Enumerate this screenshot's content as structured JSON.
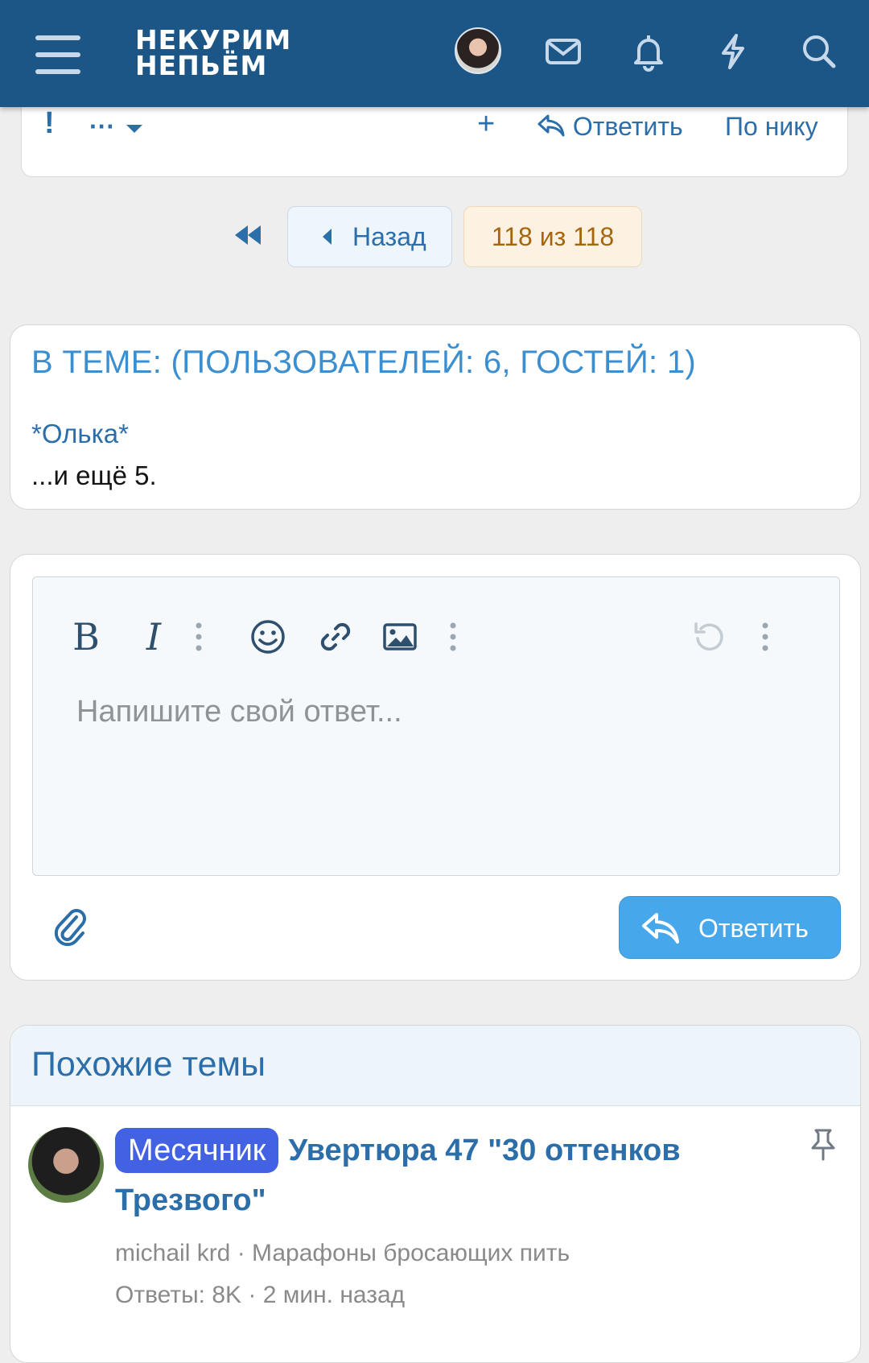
{
  "header": {
    "logo_line1": "НЕКУРИМ",
    "logo_line2": "НЕПЬЁМ",
    "icons": [
      "menu-icon",
      "avatar",
      "mail-icon",
      "bell-icon",
      "lightning-icon",
      "search-icon"
    ]
  },
  "post_actions": {
    "report": "!",
    "more": "···",
    "add": "+",
    "reply": "Ответить",
    "by_nick": "По нику"
  },
  "pagination": {
    "back": "Назад",
    "current": "118 из 118"
  },
  "online": {
    "title": "В ТЕМЕ: (ПОЛЬЗОВАТЕЛЕЙ: 6, ГОСТЕЙ: 1)",
    "user": "*Олька*",
    "more": "...и ещё 5."
  },
  "editor": {
    "bold": "B",
    "italic": "I",
    "placeholder": "Напишите свой ответ...",
    "submit": "Ответить"
  },
  "similar": {
    "heading": "Похожие темы",
    "threads": [
      {
        "prefix": "Месячник",
        "title": "Увертюра 47 \"30 оттенков Трезвого\"",
        "author_forum": "michail krd · Марафоны бросающих пить",
        "stats": "Ответы: 8K · 2 мин. назад"
      }
    ]
  },
  "colors": {
    "header_bg": "#1c5687",
    "link": "#2b6eaa",
    "accent_button": "#47a7eb",
    "prefix_badge": "#4262e3",
    "current_page_bg": "#fdf1e1"
  }
}
